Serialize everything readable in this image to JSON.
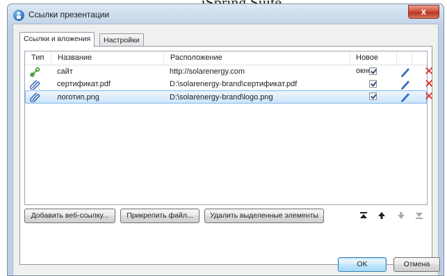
{
  "page_caption": "iSpring Suite.",
  "window": {
    "title": "Ссылки презентации",
    "close_symbol": "x"
  },
  "tabs": [
    {
      "label": "Ссылки и вложения",
      "active": true
    },
    {
      "label": "Настройки",
      "active": false
    }
  ],
  "table": {
    "columns": {
      "type": "Тип",
      "name": "Название",
      "location": "Расположение",
      "new_window": "Новое окно"
    },
    "rows": [
      {
        "type_icon": "link-icon",
        "name": "сайт",
        "location": "http://solarenergy.com",
        "new_window": true,
        "selected": false
      },
      {
        "type_icon": "paperclip-icon",
        "name": "сертификат.pdf",
        "location": "D:\\solarenergy-brand\\сертификат.pdf",
        "new_window": true,
        "selected": false
      },
      {
        "type_icon": "paperclip-icon",
        "name": "логотип.png",
        "location": "D:\\solarenergy-brand\\logo.png",
        "new_window": true,
        "selected": true
      }
    ],
    "row_action_icons": [
      "pencil-icon",
      "delete-icon"
    ]
  },
  "buttons": {
    "add_web_link": "Добавить веб-ссылку...",
    "attach_file": "Прикрепить файл...",
    "delete_selected": "Удалить выделенные элементы",
    "ok": "OK",
    "cancel": "Отмена"
  },
  "move_buttons": [
    "move-top-icon",
    "move-up-icon",
    "move-down-icon",
    "move-bottom-icon"
  ],
  "colors": {
    "delete_red": "#e0201b",
    "selection_border": "#7fb6ea",
    "pencil_blue": "#2f6fc7",
    "link_green": "#3a9a2a"
  }
}
